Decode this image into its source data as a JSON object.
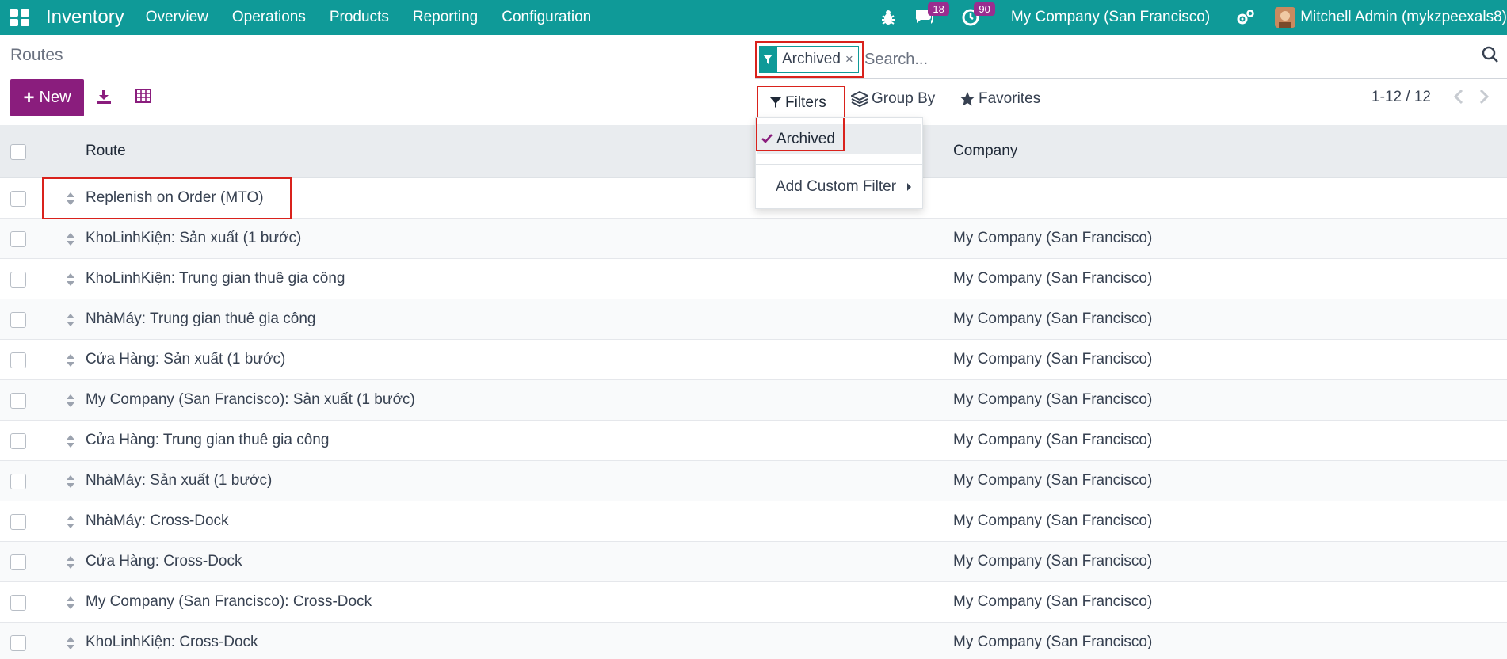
{
  "navbar": {
    "app_name": "Inventory",
    "menu": [
      "Overview",
      "Operations",
      "Products",
      "Reporting",
      "Configuration"
    ],
    "messages_count": "18",
    "activities_count": "90",
    "company": "My Company (San Francisco)",
    "user": "Mitchell Admin (mykzpeexals8)"
  },
  "control_panel": {
    "breadcrumb": "Routes",
    "new_label": "New",
    "search": {
      "facet_label": "Archived",
      "facet_close": "×",
      "placeholder": "Search..."
    },
    "filters_label": "Filters",
    "groupby_label": "Group By",
    "favorites_label": "Favorites",
    "pager": "1-12 / 12"
  },
  "filters_dropdown": {
    "archived_label": "Archived",
    "custom_filter_label": "Add Custom Filter"
  },
  "table": {
    "columns": [
      "Route",
      "Company"
    ],
    "rows": [
      {
        "route": "Replenish on Order (MTO)",
        "company": ""
      },
      {
        "route": "KhoLinhKiện: Sản xuất (1 bước)",
        "company": "My Company (San Francisco)"
      },
      {
        "route": "KhoLinhKiện: Trung gian thuê gia công",
        "company": "My Company (San Francisco)"
      },
      {
        "route": "NhàMáy: Trung gian thuê gia công",
        "company": "My Company (San Francisco)"
      },
      {
        "route": "Cửa Hàng: Sản xuất (1 bước)",
        "company": "My Company (San Francisco)"
      },
      {
        "route": "My Company (San Francisco): Sản xuất (1 bước)",
        "company": "My Company (San Francisco)"
      },
      {
        "route": "Cửa Hàng: Trung gian thuê gia công",
        "company": "My Company (San Francisco)"
      },
      {
        "route": "NhàMáy: Sản xuất (1 bước)",
        "company": "My Company (San Francisco)"
      },
      {
        "route": "NhàMáy: Cross-Dock",
        "company": "My Company (San Francisco)"
      },
      {
        "route": "Cửa Hàng: Cross-Dock",
        "company": "My Company (San Francisco)"
      },
      {
        "route": "My Company (San Francisco): Cross-Dock",
        "company": "My Company (San Francisco)"
      },
      {
        "route": "KhoLinhKiện: Cross-Dock",
        "company": "My Company (San Francisco)"
      }
    ]
  },
  "colors": {
    "navbar": "#0f9a98",
    "primary_button": "#8a1d7d",
    "annotation_red": "#d9221c",
    "badge": "#9a2d8f"
  },
  "icons": [
    "apps-icon",
    "bug-icon",
    "chat-icon",
    "clock-icon",
    "settings-icon",
    "download-icon",
    "spreadsheet-icon",
    "filter-icon",
    "layers-icon",
    "star-icon",
    "search-icon",
    "check-icon",
    "drag-handle-icon"
  ]
}
